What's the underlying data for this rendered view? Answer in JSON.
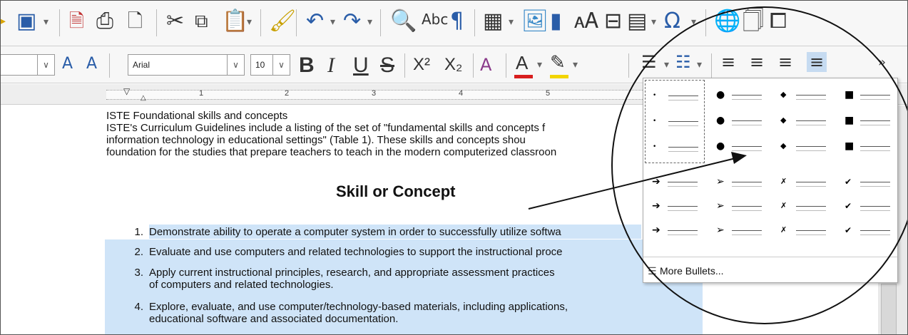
{
  "toolbar1": {
    "icons": [
      "save-icon",
      "export-pdf-icon",
      "print-icon",
      "print-preview-icon",
      "cut-icon",
      "copy-icon",
      "paste-icon",
      "clone-formatting-icon",
      "undo-icon",
      "redo-icon",
      "find-replace-icon",
      "spelling-icon",
      "formatting-marks-icon",
      "insert-table-icon",
      "insert-image-icon",
      "insert-chart-icon",
      "insert-textbox-icon",
      "page-break-icon",
      "insert-field-icon",
      "special-character-icon",
      "hyperlink-icon",
      "footnote-icon",
      "comment-icon"
    ],
    "omega": "Ω",
    "pilcrow": "¶",
    "abc": "Abc"
  },
  "toolbar2": {
    "font_name": "Arial",
    "font_size": "10",
    "bold": "B",
    "italic": "I",
    "underline": "U",
    "strike": "S",
    "superscript": "X²",
    "subscript": "X₂",
    "font_color": "A",
    "more": "»"
  },
  "ruler": {
    "numbers": [
      "1",
      "2",
      "3",
      "4",
      "5"
    ]
  },
  "document": {
    "line1": "ISTE Foundational skills and concepts",
    "line2": "ISTE's Curriculum Guidelines include a listing of the set of \"fundamental skills and concepts f",
    "line3": "information technology in educational settings\" (Table 1).  These skills and concepts shou",
    "line4": "foundation for the studies that prepare teachers to teach in the modern computerized classroon",
    "heading": "Skill or Concept",
    "items": [
      {
        "num": "1.",
        "text": "Demonstrate ability to operate a computer system in order to successfully utilize softwa"
      },
      {
        "num": "2.",
        "text": "Evaluate and use computers and related technologies to support the instructional proce"
      },
      {
        "num": "3.",
        "text": "Apply current instructional principles, research, and appropriate assessment practices"
      },
      {
        "num": "",
        "text": "of computers and related technologies."
      },
      {
        "num": "4.",
        "text": "Explore,   evaluate,   and   use   computer/technology-based   materials,   including   applications,"
      },
      {
        "num": "",
        "text": "educational software and associated documentation."
      }
    ]
  },
  "bullets_popup": {
    "more_label": "More Bullets...",
    "glyphs": [
      "•",
      "●",
      "◆",
      "■",
      "➔",
      "➢",
      "✗",
      "✔"
    ]
  },
  "colors": {
    "highlight": "#cfe4f8",
    "font_color_red": "#d81e1e",
    "highlight_yellow": "#f2d500",
    "save_blue": "#2a5da8"
  }
}
